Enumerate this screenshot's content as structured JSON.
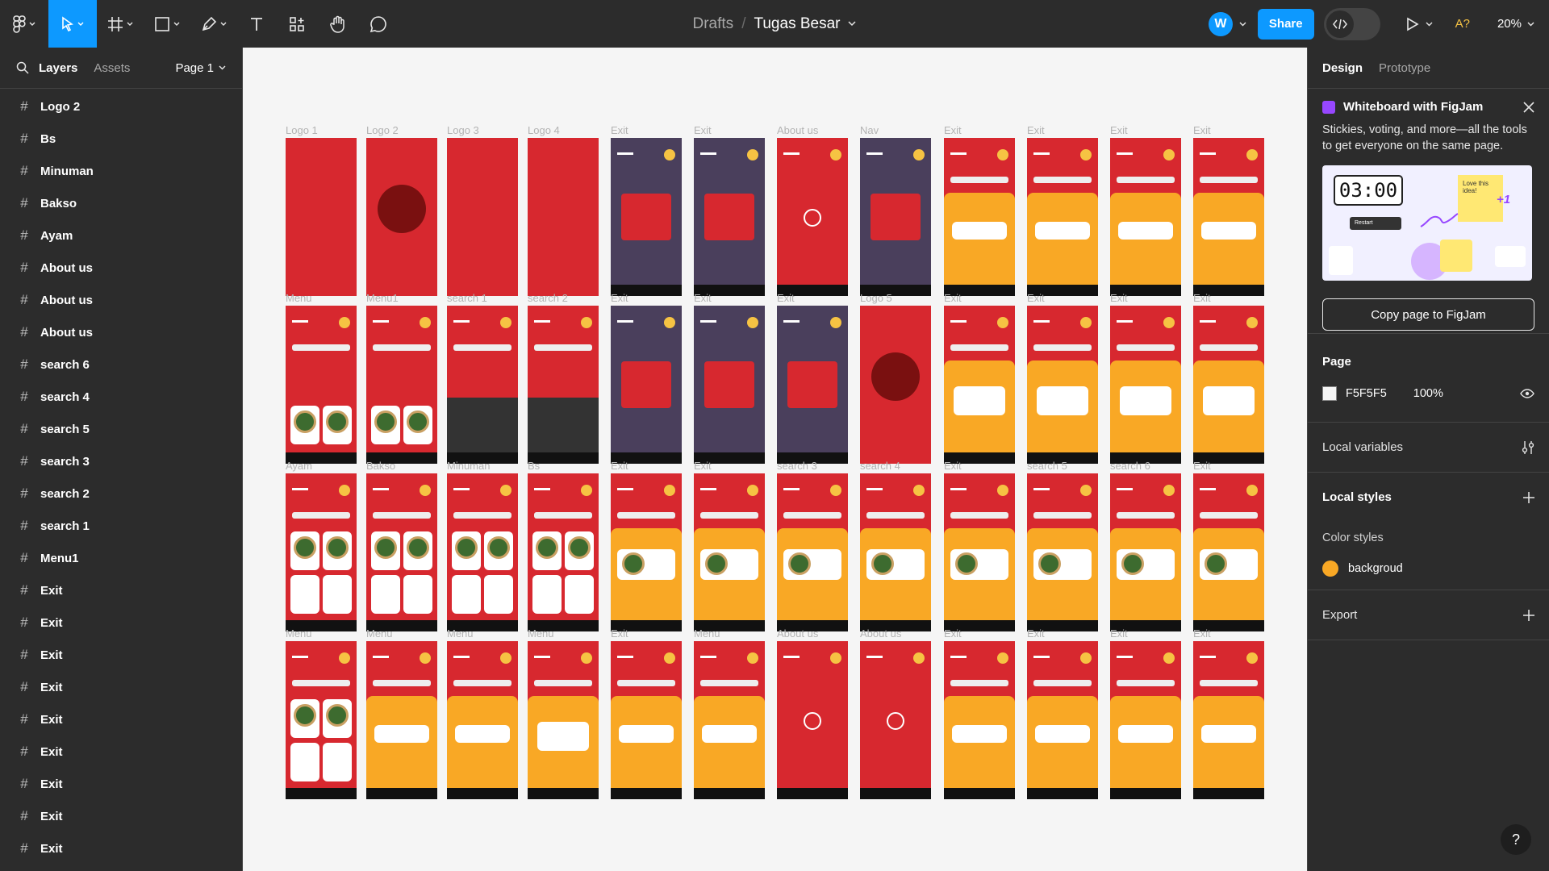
{
  "toolbar": {
    "tools": [
      "main-menu",
      "move-tool",
      "frame-tool",
      "shape-tool",
      "pen-tool",
      "text-tool",
      "resources-tool",
      "hand-tool",
      "comment-tool"
    ]
  },
  "breadcrumb": {
    "drafts": "Drafts",
    "separator": "/",
    "file_name": "Tugas Besar"
  },
  "topright": {
    "avatar_initial": "W",
    "share_label": "Share",
    "ai_label": "A?",
    "zoom": "20%"
  },
  "left_panel": {
    "tab_layers": "Layers",
    "tab_assets": "Assets",
    "page_selector": "Page 1",
    "layers": [
      "Logo 2",
      "Bs",
      "Minuman",
      "Bakso",
      "Ayam",
      "About us",
      "About us",
      "About us",
      "search 6",
      "search 4",
      "search 5",
      "search 3",
      "search 2",
      "search 1",
      "Menu1",
      "Exit",
      "Exit",
      "Exit",
      "Exit",
      "Exit",
      "Exit",
      "Exit",
      "Exit",
      "Exit"
    ]
  },
  "canvas": {
    "frame_labels": [
      [
        "Logo 1",
        "Logo 2",
        "Logo 3",
        "Logo 4",
        "Exit",
        "Exit",
        "About us",
        "Nav",
        "Exit",
        "Exit",
        "Exit",
        "Exit"
      ],
      [
        "Menu",
        "Menu1",
        "search 1",
        "search 2",
        "Exit",
        "Exit",
        "Exit",
        "Logo 5",
        "Exit",
        "Exit",
        "Exit",
        "Exit"
      ],
      [
        "Ayam",
        "Bakso",
        "Minuman",
        "Bs",
        "Exit",
        "Exit",
        "search 3",
        "search 4",
        "Exit",
        "search 5",
        "search 6",
        "Exit"
      ],
      [
        "Menu",
        "Menu",
        "Menu",
        "Menu",
        "Exit",
        "Menu",
        "About us",
        "About us",
        "Exit",
        "Exit",
        "Exit",
        "Exit"
      ]
    ],
    "frame_kinds": [
      [
        "plain",
        "logo",
        "plain",
        "plain",
        "dark",
        "dark",
        "about",
        "dark",
        "order",
        "order",
        "order",
        "order"
      ],
      [
        "menu",
        "menu",
        "keyboard",
        "keyboard",
        "dark",
        "dark",
        "dark",
        "logo",
        "map",
        "map",
        "map",
        "map"
      ],
      [
        "list",
        "list",
        "list",
        "list",
        "cart",
        "cart",
        "cart",
        "cart",
        "cart",
        "cart",
        "cart",
        "cart"
      ],
      [
        "list",
        "checkout",
        "checkout",
        "map",
        "order",
        "order",
        "done",
        "done",
        "order",
        "order",
        "order",
        "order"
      ]
    ]
  },
  "right_panel": {
    "tab_design": "Design",
    "tab_prototype": "Prototype",
    "promo": {
      "title": "Whiteboard with FigJam",
      "body": "Stickies, voting, and more—all the tools to get everyone on the same page.",
      "timer": "03:00",
      "restart": "Restart",
      "sticky": "Love this idea!",
      "plus": "+1",
      "button": "Copy page to FigJam"
    },
    "page": {
      "title": "Page",
      "color_hex": "F5F5F5",
      "opacity": "100%"
    },
    "local_variables": "Local variables",
    "local_styles": "Local styles",
    "color_styles": "Color styles",
    "style_name": "backgroud",
    "export": "Export"
  },
  "colors": {
    "accent": "#0d99ff",
    "frame_red": "#d7282f",
    "frame_orange": "#f9a825",
    "panel": "#2c2c2c",
    "canvas": "#f5f5f5"
  }
}
